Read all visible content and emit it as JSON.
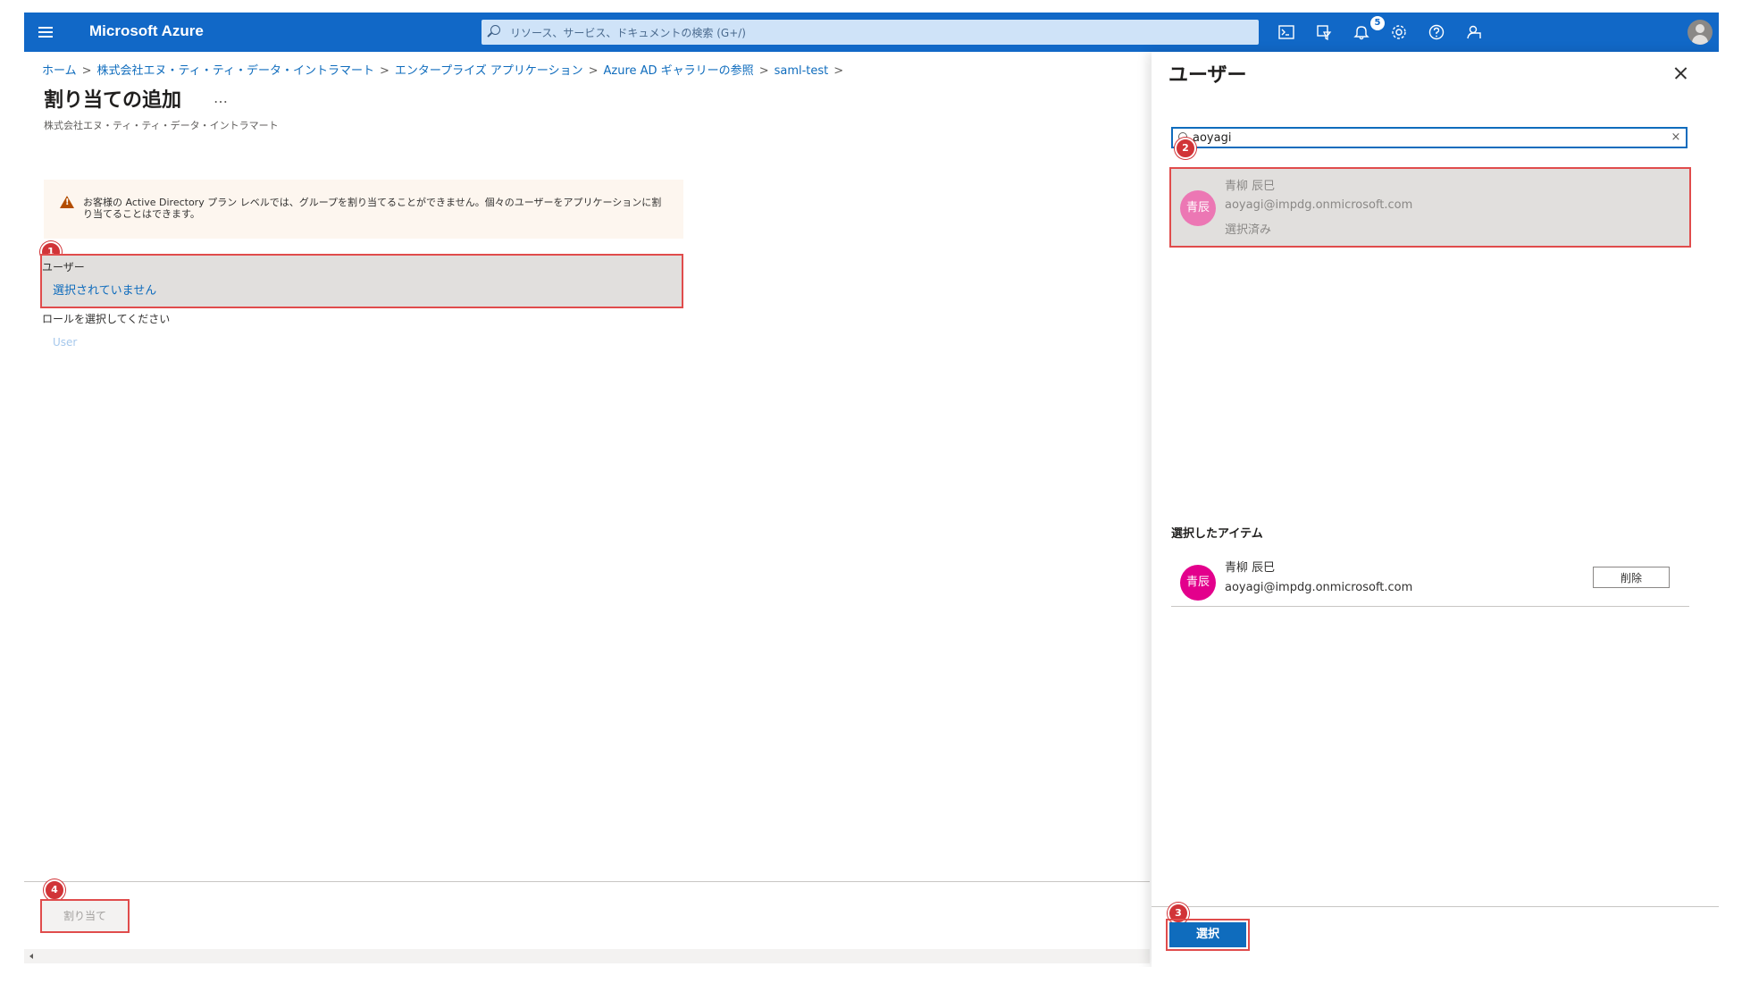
{
  "topbar": {
    "brand": "Microsoft Azure",
    "search_placeholder": "リソース、サービス、ドキュメントの検索 (G+/)",
    "notification_count": "5",
    "icons": [
      "cloud-shell-icon",
      "directory-filter-icon",
      "notifications-icon",
      "settings-icon",
      "help-icon",
      "feedback-icon"
    ]
  },
  "breadcrumb": {
    "items": [
      "ホーム",
      "株式会社エヌ・ティ・ティ・データ・イントラマート",
      "エンタープライズ アプリケーション",
      "Azure AD ギャラリーの参照",
      "saml-test"
    ],
    "separator": ">"
  },
  "page": {
    "title": "割り当ての追加",
    "more": "…",
    "subtitle": "株式会社エヌ・ティ・ティ・データ・イントラマート",
    "warning": "お客様の Active Directory プラン レベルでは、グループを割り当てることができません。個々のユーザーをアプリケーションに割り当てることはできます。",
    "user_label": "ユーザー",
    "user_value": "選択されていません",
    "role_label": "ロールを選択してください",
    "role_value": "User",
    "assign_button": "割り当て"
  },
  "steps": [
    "1",
    "2",
    "3",
    "4"
  ],
  "panel": {
    "title": "ユーザー",
    "search_value": "aoyagi",
    "clear": "×",
    "result": {
      "avatar": "青辰",
      "name": "青柳 辰巳",
      "email": "aoyagi@impdg.onmicrosoft.com",
      "status": "選択済み"
    },
    "selected_heading": "選択したアイテム",
    "selected": {
      "avatar": "青辰",
      "name": "青柳 辰巳",
      "email": "aoyagi@impdg.onmicrosoft.com",
      "remove_button": "削除"
    },
    "select_button": "選択"
  },
  "colors": {
    "topbar": "#1168c7",
    "link": "#0f6cbd",
    "highlight": "#e04c4c",
    "avatar_result": "#ec77b4",
    "avatar_selected": "#e3008c"
  }
}
